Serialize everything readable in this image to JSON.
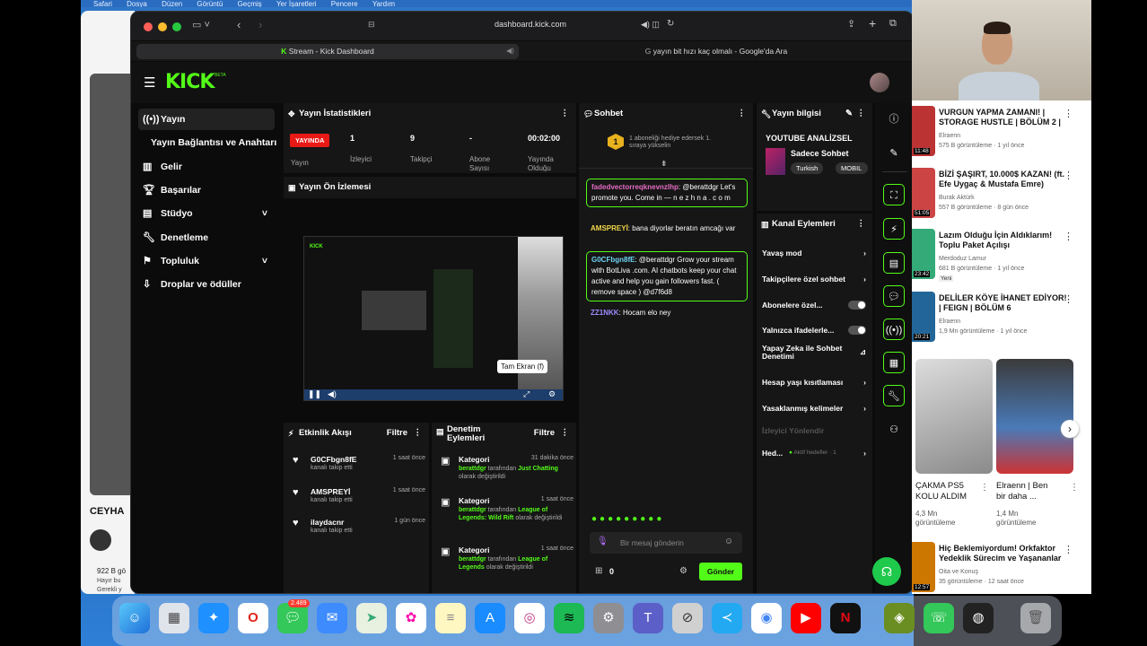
{
  "menubar": {
    "items": [
      "Safari",
      "Dosya",
      "Düzen",
      "Görüntü",
      "Geçmiş",
      "Yer İşaretleri",
      "Pencere",
      "Yardım"
    ]
  },
  "browser": {
    "url": "dashboard.kick.com",
    "tabs": [
      {
        "label": "Stream - Kick Dashboard"
      },
      {
        "label": "yayın bit hızı kaç olmalı - Google'da Ara"
      }
    ]
  },
  "kick": {
    "logo": "KICK",
    "logo_badge": "BETA",
    "sidebar": [
      {
        "label": "Yayın",
        "icon": "broadcast-icon",
        "active": true
      },
      {
        "label": "Yayın Bağlantısı ve Anahtarı",
        "icon": "",
        "sub": true
      },
      {
        "label": "Gelir",
        "icon": "chart-icon"
      },
      {
        "label": "Başarılar",
        "icon": "trophy-icon"
      },
      {
        "label": "Stüdyo",
        "icon": "studio-icon",
        "expand": true
      },
      {
        "label": "Denetleme",
        "icon": "wrench-icon"
      },
      {
        "label": "Topluluk",
        "icon": "community-icon",
        "expand": true
      },
      {
        "label": "Droplar ve ödüller",
        "icon": "drops-icon"
      }
    ],
    "stats": {
      "title": "Yayın İstatistikleri",
      "live_badge": "YAYINDA",
      "columns": [
        {
          "value": "1",
          "label": "İzleyici"
        },
        {
          "value": "9",
          "label": "Takipçi"
        },
        {
          "value": "-",
          "label": "Abone Sayısı"
        },
        {
          "value": "00:02:00",
          "label": "Yayında Olduğu"
        }
      ],
      "first_label": "Yayın"
    },
    "preview": {
      "title": "Yayın Ön İzlemesi",
      "tooltip": "Tam Ekran (f)"
    },
    "chat": {
      "title": "Sohbet",
      "gift": "1 aboneliği hediye edersek 1. sıraya yükselin",
      "messages": [
        {
          "user": "fadedvectorreqknevnzlhp",
          "text": ": @berattdgr Let's promote you. Come in — n e z h n a . c o m",
          "boxed": true
        },
        {
          "user": "AMSPREYİ",
          "text": ": bana diyorlar beratın amcağı var",
          "boxed": false
        },
        {
          "user": "G0CFbgn8fE",
          "text": ": @berattdgr Grow your stream with BotLiva .com. AI chatbots keep your chat active and help you gain followers fast. ( remove space ) @d7f6d8",
          "boxed": true
        },
        {
          "user": "ZZ1NKK",
          "text": ": Hocam elo ney",
          "boxed": false
        }
      ],
      "input_placeholder": "Bir mesaj gönderin",
      "points": "0",
      "send_label": "Gönder"
    },
    "stream_info": {
      "title": "Yayın bilgisi",
      "stream_title": "YOUTUBE ANALİZSEL",
      "category": "Sadece Sohbet",
      "tags": [
        "Turkish",
        "MOBIL"
      ]
    },
    "channel_actions": {
      "title": "Kanal Eylemleri",
      "rows": [
        {
          "label": "Yavaş mod",
          "type": "arrow"
        },
        {
          "label": "Takipçilere özel sohbet",
          "type": "arrow"
        },
        {
          "label": "Abonelere özel...",
          "type": "toggle"
        },
        {
          "label": "Yalnızca ifadelerle...",
          "type": "toggle"
        },
        {
          "label": "Yapay Zeka ile Sohbet Denetimi",
          "type": "icon"
        },
        {
          "label": "Hesap yaşı kısıtlaması",
          "type": "arrow"
        },
        {
          "label": "Yasaklanmış kelimeler",
          "type": "arrow"
        },
        {
          "label": "İzleyici Yönlendir",
          "type": "disabled"
        },
        {
          "label": "Hed...",
          "type": "arrow",
          "extra": "Aktif hedefler · 1"
        }
      ]
    },
    "activity": {
      "title": "Etkinlik Akışı",
      "filter": "Filtre",
      "items": [
        {
          "name": "G0CFbgn8fE",
          "sub": "kanalı takip etti",
          "time": "1 saat önce"
        },
        {
          "name": "AMSPREYİ",
          "sub": "kanalı takip etti",
          "time": "1 saat önce"
        },
        {
          "name": "ilaydacnr",
          "sub": "kanalı takip etti",
          "time": "1 gün önce"
        }
      ]
    },
    "moderation": {
      "title": "Denetim Eylemleri",
      "filter": "Filtre",
      "items": [
        {
          "name": "Kategori",
          "time": "31 dakika önce",
          "who": "berattdgr",
          "mid": " tarafından ",
          "what": "Just Chatting",
          "end": " olarak değiştirildi"
        },
        {
          "name": "Kategori",
          "time": "1 saat önce",
          "who": "berattdgr",
          "mid": " tarafından ",
          "what": "League of Legends: Wild Rift",
          "end": " olarak değiştirildi"
        },
        {
          "name": "Kategori",
          "time": "1 saat önce",
          "who": "berattdgr",
          "mid": " tarafından ",
          "what": "League of Legends",
          "end": " olarak değiştirildi"
        }
      ]
    }
  },
  "youtube": {
    "items": [
      {
        "title": "VURGUN YAPMA ZAMANI! | STORAGE HUSTLE | BÖLÜM 2 |",
        "channel": "Elraenn",
        "meta": "575 B görüntüleme · 1 yıl önce",
        "duration": "11:48",
        "color": "#b33"
      },
      {
        "title": "BİZİ ŞAŞIRT, 10.000$ KAZAN! (ft. Efe Uygaç & Mustafa Emre)",
        "channel": "Burak Aktürk",
        "meta": "557 B görüntüleme · 8 gün önce",
        "duration": "51:05",
        "color": "#c44"
      },
      {
        "title": "Lazım Olduğu İçin Aldıklarım! Toplu Paket Açılışı",
        "channel": "Merdoduz Lamur",
        "meta": "681 B görüntüleme · 1 yıl önce",
        "duration": "23:42",
        "color": "#3a7"
      },
      {
        "title": "DELİLER KÖYE İHANET EDİYOR! | FEIGN | BÖLÜM 6",
        "channel": "Elraenn",
        "meta": "1,9 Mn görüntüleme · 1 yıl önce",
        "duration": "20:21",
        "color": "#269"
      }
    ],
    "new_badge": "Yeni",
    "shorts": [
      {
        "title": "ÇAKMA PS5 KOLU ALDIM",
        "views": "4,3 Mn görüntüleme"
      },
      {
        "title": "Elraenn | Ben bir daha ...",
        "views": "1,4 Mn görüntüleme"
      }
    ],
    "last": {
      "title": "Hiç Beklemiyordum! Orkfaktor Yedeklik Sürecim ve Yaşananlar",
      "channel": "Oita ve Konuş",
      "meta": "35 görüntüleme · 12 saat önce",
      "duration": "12:57"
    }
  },
  "bg_window": {
    "label": "CEYHA",
    "views": "922 B gö",
    "line2": "Hayır bu",
    "line3": "Gerekli y"
  },
  "dock": {
    "messages_badge": "2.489"
  }
}
